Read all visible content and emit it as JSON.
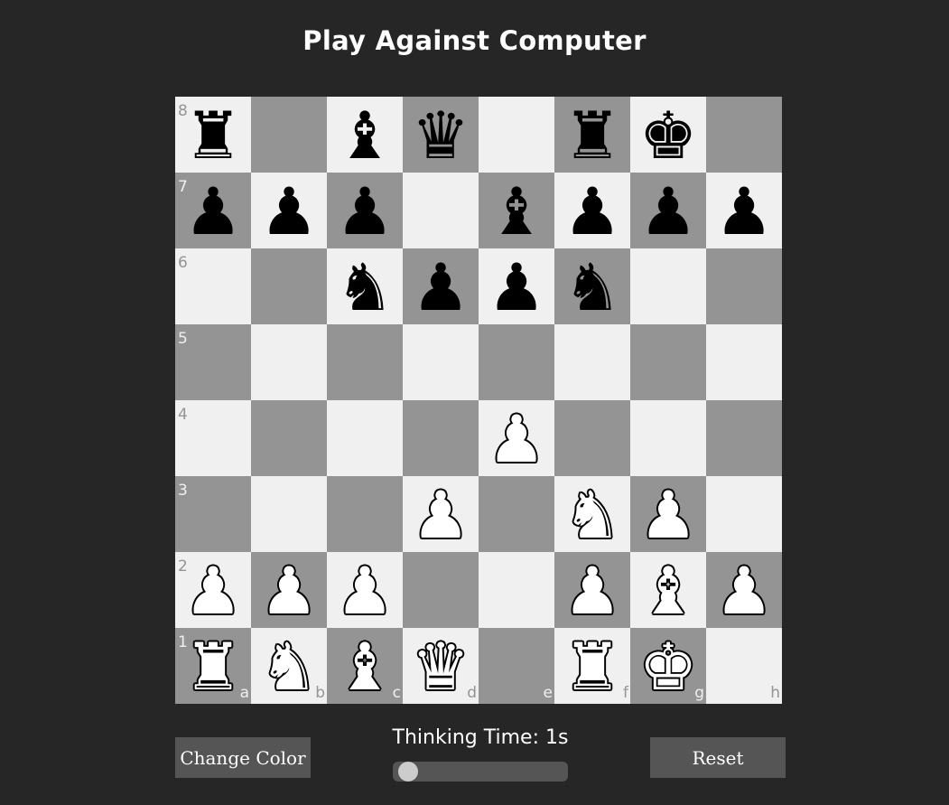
{
  "header": {
    "title": "Play Against Computer"
  },
  "board": {
    "files": [
      "a",
      "b",
      "c",
      "d",
      "e",
      "f",
      "g",
      "h"
    ],
    "ranks": [
      "8",
      "7",
      "6",
      "5",
      "4",
      "3",
      "2",
      "1"
    ],
    "light_color": "#f0f0f0",
    "dark_color": "#949494",
    "rows": [
      [
        "bR",
        "",
        "bB",
        "bQ",
        "",
        "bR",
        "bK",
        ""
      ],
      [
        "bP",
        "bP",
        "bP",
        "",
        "bB",
        "bP",
        "bP",
        "bP"
      ],
      [
        "",
        "",
        "bN",
        "bP",
        "bP",
        "bN",
        "",
        ""
      ],
      [
        "",
        "",
        "",
        "",
        "",
        "",
        "",
        ""
      ],
      [
        "",
        "",
        "",
        "",
        "wP",
        "",
        "",
        ""
      ],
      [
        "",
        "",
        "",
        "wP",
        "",
        "wN",
        "wP",
        ""
      ],
      [
        "wP",
        "wP",
        "wP",
        "",
        "",
        "wP",
        "wB",
        "wP"
      ],
      [
        "wR",
        "wN",
        "wB",
        "wQ",
        "",
        "wR",
        "wK",
        ""
      ]
    ]
  },
  "controls": {
    "change_color_label": "Change Color",
    "reset_label": "Reset",
    "thinking_label": "Thinking Time: 1s",
    "thinking_time": {
      "value": 1,
      "min": 1,
      "max": 10,
      "unit": "s"
    },
    "button_color": "#555555"
  }
}
